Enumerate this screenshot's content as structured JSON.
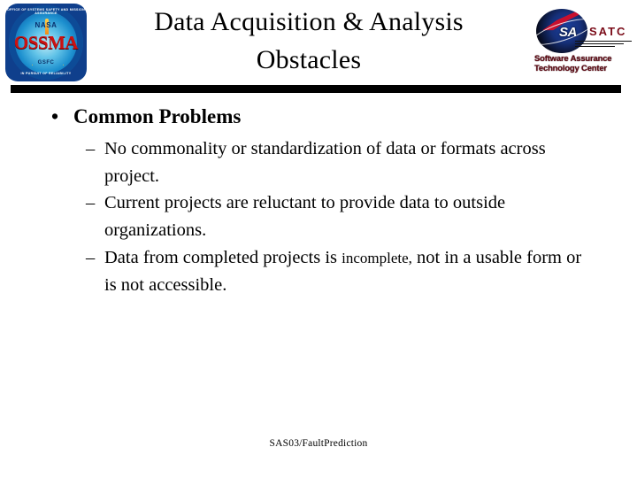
{
  "slide": {
    "title": "Data Acquisition & Analysis Obstacles",
    "title_lines": [
      "Data Acquisition & Analysis",
      "Obstacles"
    ],
    "footer": "SAS03/FaultPrediction",
    "background_color": "#ffffff",
    "text_color": "#000000",
    "divider_color": "#000000"
  },
  "logos": {
    "left": {
      "name": "OSSMA NASA GSFC seal",
      "ring_text_top": "OFFICE OF SYSTEMS SAFETY AND MISSION ASSURANCE",
      "ring_text_bottom": "IN PURSUIT OF RELIABILITY",
      "agency": "NASA",
      "acronym": "OSSMA",
      "center": "GSFC",
      "colors": {
        "acronym": "#cc1111",
        "field": "#1c8fce",
        "border": "#0f3f8c"
      }
    },
    "right": {
      "name": "Software Assurance Technology Center",
      "mark": "SA",
      "letters": "SATC",
      "title_lines": [
        "Software Assurance",
        "Technology Center"
      ],
      "colors": {
        "letters": "#7a0b18",
        "swoosh": "#c8102e",
        "sphere": "#16307a"
      }
    }
  },
  "content": {
    "bullet_marker": "•",
    "sub_marker": "–",
    "level1": {
      "text": "Common Problems"
    },
    "level2": [
      {
        "parts": [
          {
            "text": "No commonality or standardization of data or formats across project.",
            "small": false
          }
        ],
        "plain": "No commonality or standardization of data or formats across project."
      },
      {
        "parts": [
          {
            "text": "Current projects are reluctant to provide data to outside organizations.",
            "small": false
          }
        ],
        "plain": "Current projects are reluctant to provide data to outside organizations."
      },
      {
        "parts": [
          {
            "text": "Data from completed projects is ",
            "small": false
          },
          {
            "text": "incomplete,",
            "small": true
          },
          {
            "text": " not in a usable form or is not accessible.",
            "small": false
          }
        ],
        "plain": "Data from completed projects is incomplete, not in a usable form or is not accessible."
      }
    ]
  }
}
